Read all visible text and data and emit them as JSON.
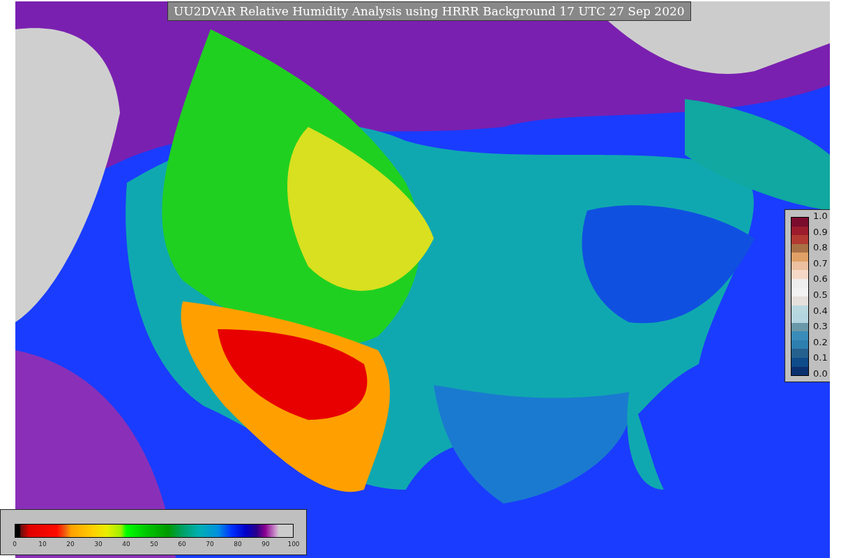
{
  "title": "UU2DVAR Relative Humidity Analysis using HRRR Background 17 UTC 27 Sep 2020",
  "legend": {
    "ticks": [
      "1.0",
      "0.9",
      "0.8",
      "0.7",
      "0.6",
      "0.5",
      "0.4",
      "0.3",
      "0.2",
      "0.1",
      "0.0"
    ]
  },
  "colorbar": {
    "ticks": [
      "0",
      "10",
      "20",
      "30",
      "40",
      "50",
      "60",
      "70",
      "80",
      "90",
      "100"
    ]
  }
}
